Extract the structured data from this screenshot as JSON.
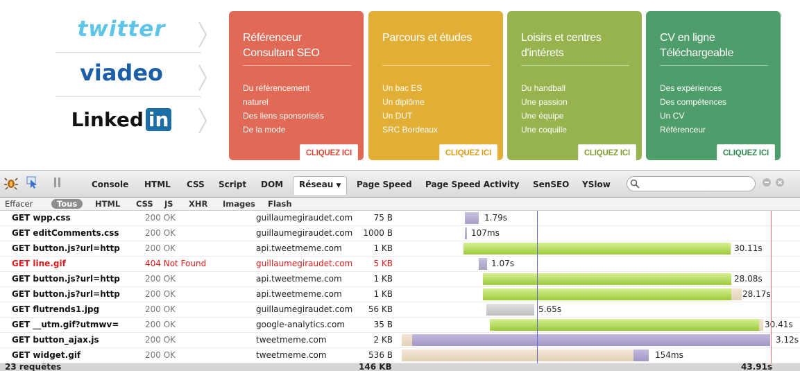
{
  "social": [
    {
      "label": "twitter",
      "color": "#5ec4e8"
    },
    {
      "label": "viadeo",
      "color": "#1d5fa6"
    },
    {
      "label": "Linked",
      "suffix": "in",
      "color": "#111111",
      "suffix_bg": "#1b6fa6"
    }
  ],
  "cards": [
    {
      "title": "Référenceur Consultant SEO",
      "items": [
        "Du référencement",
        "naturel",
        "Des liens sponsorisés",
        "De la mode"
      ],
      "button": "CLIQUEZ ICI",
      "color": "#e06a56",
      "btn_color": "#d54632"
    },
    {
      "title": "Parcours et études",
      "items": [
        "Un bac ES",
        "Un diplôme",
        "Un DUT",
        "SRC Bordeaux"
      ],
      "button": "CLIQUEZ ICI",
      "color": "#e1ae36",
      "btn_color": "#d79b18"
    },
    {
      "title": "Loisirs et centres d'intérets",
      "items": [
        "Du handball",
        "Une passion",
        "Une équipe",
        "Une coquille"
      ],
      "button": "CLIQUEZ ICI",
      "color": "#97b34e",
      "btn_color": "#7e9c33"
    },
    {
      "title": "CV en ligne Téléchargeable",
      "items": [
        "Des expériences",
        "Des compétences",
        "Un CV",
        "Référenceur"
      ],
      "button": "CLIQUEZ ICI",
      "color": "#4f9d6a",
      "btn_color": "#2f8751"
    }
  ],
  "toolbar": {
    "tabs": [
      "Console",
      "HTML",
      "CSS",
      "Script",
      "DOM",
      "Réseau",
      "Page Speed",
      "Page Speed Activity",
      "SenSEO",
      "YSlow"
    ],
    "active": "Réseau"
  },
  "filters": {
    "clear": "Effacer",
    "items": [
      "Tous",
      "HTML",
      "CSS",
      "JS",
      "XHR",
      "Images",
      "Flash"
    ]
  },
  "requests": [
    {
      "req": "GET wpp.css",
      "status": "200 OK",
      "domain": "guillaumegiraudet.com",
      "size": "75 B",
      "time": "1.79s",
      "bar": {
        "start": 0.164,
        "wait": 0.036,
        "recv": 0.0,
        "fill": "gray"
      }
    },
    {
      "req": "GET editComments.css",
      "status": "200 OK",
      "domain": "guillaumegiraudet.com",
      "size": "1000 B",
      "time": "107ms",
      "bar": {
        "start": 0.164,
        "wait": 0.004,
        "recv": 0.0,
        "fill": "gray"
      }
    },
    {
      "req": "GET button.js?url=http",
      "status": "200 OK",
      "domain": "api.tweetmeme.com",
      "size": "1 KB",
      "time": "30.11s",
      "bar": {
        "start": 0.164,
        "wait": 0.0,
        "recv": 0.685,
        "fill": "green"
      }
    },
    {
      "req": "GET line.gif",
      "status": "404 Not Found",
      "domain": "guillaumegiraudet.com",
      "size": "5 KB",
      "time": "1.07s",
      "error": true,
      "bar": {
        "start": 0.208,
        "wait": 0.021,
        "recv": 0.0,
        "fill": "gray"
      }
    },
    {
      "req": "GET button.js?url=http",
      "status": "200 OK",
      "domain": "api.tweetmeme.com",
      "size": "1 KB",
      "time": "28.08s",
      "bar": {
        "start": 0.21,
        "wait": 0.0,
        "recv": 0.638,
        "fill": "green"
      }
    },
    {
      "req": "GET button.js?url=http",
      "status": "200 OK",
      "domain": "api.tweetmeme.com",
      "size": "1 KB",
      "time": "28.17s",
      "bar": {
        "start": 0.21,
        "wait": 0.0,
        "recv": 0.64,
        "fill": "green",
        "tail": 0.028
      }
    },
    {
      "req": "GET flutrends1.jpg",
      "status": "200 OK",
      "domain": "guillaumegiraudet.com",
      "size": "56 KB",
      "time": "5.65s",
      "bar": {
        "start": 0.22,
        "wait": 0.0,
        "recv": 0.128,
        "fill": "lightgray"
      }
    },
    {
      "req": "GET __utm.gif?utmwv=",
      "status": "200 OK",
      "domain": "google-analytics.com",
      "size": "35 B",
      "time": "30.41s",
      "bar": {
        "start": 0.228,
        "wait": 0.0,
        "recv": 0.691,
        "fill": "green"
      }
    },
    {
      "req": "GET button_ajax.js",
      "status": "200 OK",
      "domain": "tweetmeme.com",
      "size": "2 KB",
      "time": "3.12s",
      "bar": {
        "start": 0.0,
        "wait": 0.0,
        "recv": 0.0,
        "fill": "purple"
      }
    },
    {
      "req": "GET widget.gif",
      "status": "200 OK",
      "domain": "tweetmeme.com",
      "size": "536 B",
      "time": "154ms",
      "bar": {
        "start": 0.0,
        "wait": 0.0,
        "recv": 0.0,
        "fill": "tan"
      }
    }
  ],
  "footer": {
    "count": "23 requêtes",
    "size": "146 KB",
    "time": "43.91s"
  }
}
